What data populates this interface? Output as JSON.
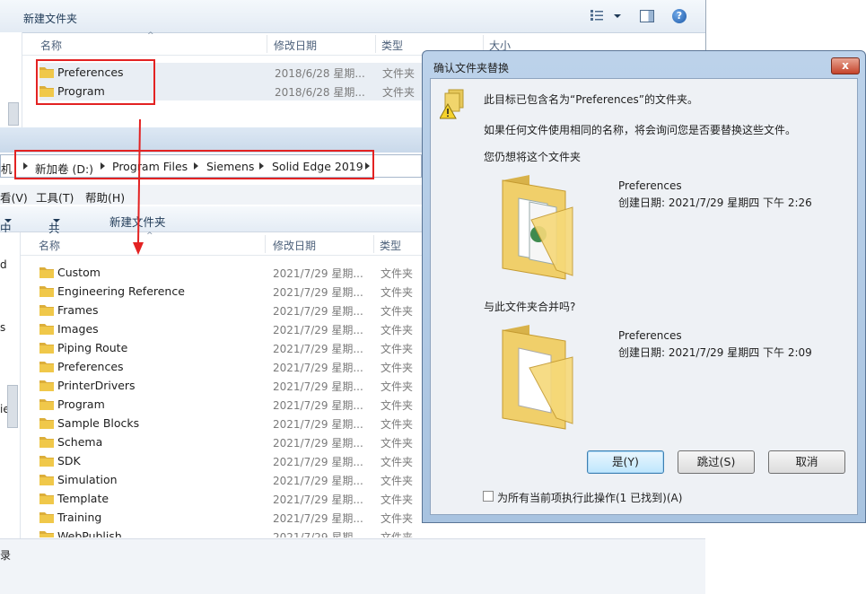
{
  "top_window": {
    "toolbar_title": "新建文件夹",
    "columns": {
      "name": "名称",
      "date": "修改日期",
      "type": "类型",
      "size": "大小"
    },
    "rows": [
      {
        "name": "Preferences",
        "date": "2018/6/28 星期...",
        "type": "文件夹"
      },
      {
        "name": "Program",
        "date": "2018/6/28 星期...",
        "type": "文件夹"
      }
    ]
  },
  "bottom_window": {
    "address": {
      "prefix": "机",
      "segments": [
        "新加卷 (D:)",
        "Program Files",
        "Siemens",
        "Solid Edge 2019"
      ]
    },
    "menu": {
      "view": "看(V)",
      "tools": "工具(T)",
      "help": "帮助(H)"
    },
    "commands": {
      "include": "中",
      "share": "共享",
      "new_folder": "新建文件夹"
    },
    "columns": {
      "name": "名称",
      "date": "修改日期",
      "type": "类型"
    },
    "left_pane_fragments": [
      "d",
      "s",
      "ie"
    ],
    "status_fragment": "录",
    "rows": [
      {
        "name": "Custom",
        "date": "2021/7/29 星期...",
        "type": "文件夹"
      },
      {
        "name": "Engineering Reference",
        "date": "2021/7/29 星期...",
        "type": "文件夹"
      },
      {
        "name": "Frames",
        "date": "2021/7/29 星期...",
        "type": "文件夹"
      },
      {
        "name": "Images",
        "date": "2021/7/29 星期...",
        "type": "文件夹"
      },
      {
        "name": "Piping Route",
        "date": "2021/7/29 星期...",
        "type": "文件夹"
      },
      {
        "name": "Preferences",
        "date": "2021/7/29 星期...",
        "type": "文件夹"
      },
      {
        "name": "PrinterDrivers",
        "date": "2021/7/29 星期...",
        "type": "文件夹"
      },
      {
        "name": "Program",
        "date": "2021/7/29 星期...",
        "type": "文件夹"
      },
      {
        "name": "Sample Blocks",
        "date": "2021/7/29 星期...",
        "type": "文件夹"
      },
      {
        "name": "Schema",
        "date": "2021/7/29 星期...",
        "type": "文件夹"
      },
      {
        "name": "SDK",
        "date": "2021/7/29 星期...",
        "type": "文件夹"
      },
      {
        "name": "Simulation",
        "date": "2021/7/29 星期...",
        "type": "文件夹"
      },
      {
        "name": "Template",
        "date": "2021/7/29 星期...",
        "type": "文件夹"
      },
      {
        "name": "Training",
        "date": "2021/7/29 星期...",
        "type": "文件夹"
      },
      {
        "name": "WebPublish",
        "date": "2021/7/29 星期...",
        "type": "文件夹"
      }
    ]
  },
  "dialog": {
    "title": "确认文件夹替换",
    "close": "x",
    "message": "此目标已包含名为“Preferences”的文件夹。",
    "info": "如果任何文件使用相同的名称，将会询问您是否要替换这些文件。",
    "question_keep": "您仍想将这个文件夹",
    "source": {
      "name": "Preferences",
      "created": "创建日期: 2021/7/29 星期四 下午 2:26"
    },
    "question_merge": "与此文件夹合并吗?",
    "target": {
      "name": "Preferences",
      "created": "创建日期: 2021/7/29 星期四 下午 2:09"
    },
    "buttons": {
      "yes": "是(Y)",
      "skip": "跳过(S)",
      "cancel": "取消"
    },
    "checkbox_label": "为所有当前项执行此操作(1 已找到)(A)"
  },
  "colors": {
    "annotation_red": "#e32222",
    "folder_yellow": "#f0c84a"
  }
}
